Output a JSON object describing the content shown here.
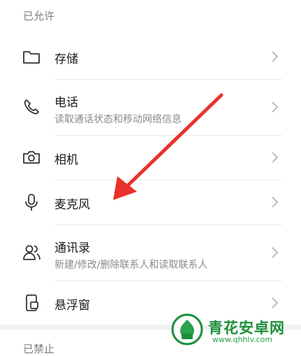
{
  "sections": {
    "allowed_title": "已允许",
    "denied_title": "已禁止"
  },
  "items": [
    {
      "title": "存储",
      "subtitle": "",
      "icon": "folder-icon"
    },
    {
      "title": "电话",
      "subtitle": "读取通话状态和移动网络信息",
      "icon": "phone-icon"
    },
    {
      "title": "相机",
      "subtitle": "",
      "icon": "camera-icon"
    },
    {
      "title": "麦克风",
      "subtitle": "",
      "icon": "microphone-icon"
    },
    {
      "title": "通讯录",
      "subtitle": "新建/修改/删除联系人和读取联系人",
      "icon": "contacts-icon"
    },
    {
      "title": "悬浮窗",
      "subtitle": "",
      "icon": "floating-window-icon"
    }
  ],
  "annotation": {
    "arrow_color": "#e8322b"
  },
  "watermark": {
    "name": "青花安卓网",
    "url": "www.qhhlv.com"
  }
}
